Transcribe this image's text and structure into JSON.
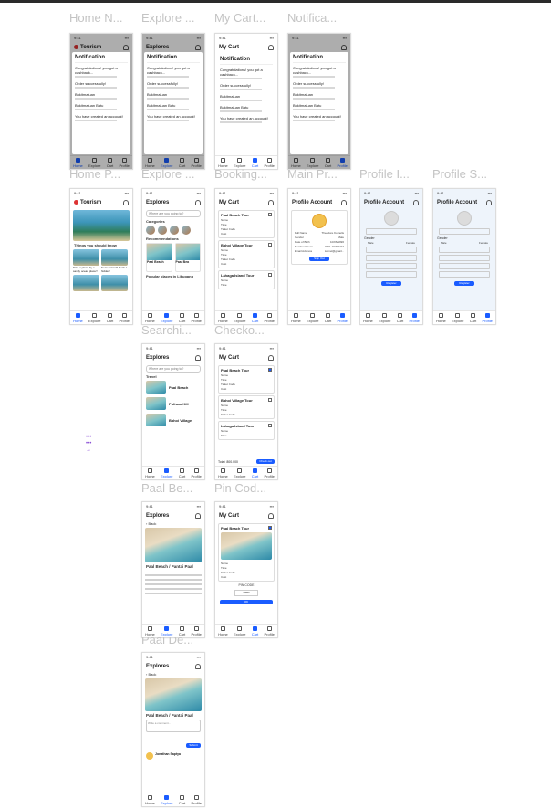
{
  "frames": {
    "home_notif": {
      "label": "Home N..."
    },
    "explore_notif": {
      "label": "Explore ..."
    },
    "cart_notif": {
      "label": "My Cart..."
    },
    "notif": {
      "label": "Notifica..."
    },
    "home_page": {
      "label": "Home P..."
    },
    "explore_page": {
      "label": "Explore ..."
    },
    "booking": {
      "label": "Booking..."
    },
    "main_profile": {
      "label": "Main Pr..."
    },
    "profile_info": {
      "label": "Profile I..."
    },
    "profile_s": {
      "label": "Profile S..."
    },
    "searching": {
      "label": "Searchi..."
    },
    "checkout": {
      "label": "Checko..."
    },
    "paal_beach": {
      "label": "Paal Be..."
    },
    "pin_code": {
      "label": "Pin Cod..."
    },
    "detail": {
      "label": "Paal De..."
    }
  },
  "app": {
    "status_time": "9:41",
    "home_title": "Tourism",
    "explore_title": "Explores",
    "cart_title": "My Cart",
    "profile_title": "Profile Account",
    "nav": {
      "home": "Home",
      "explore": "Explore",
      "cart": "Cart",
      "profile": "Profile"
    }
  },
  "notification": {
    "title": "Notification",
    "items": [
      "Congratulations! you got a cashback...",
      "Order successfully!",
      "Bukitmaluan",
      "Bukitmaluan Batu",
      "You have created an account!"
    ]
  },
  "home": {
    "things_title": "Things you should know",
    "things": [
      "Take a photo by a sandy ocean place!!",
      "Secret island! Such a hidden!"
    ]
  },
  "explore": {
    "search_placeholder": "Where are you going to?",
    "categories_title": "Categories",
    "recommendations_title": "Recommendations",
    "popular_title": "Popular places in Likupang",
    "cards": [
      "Paal Beach",
      "Paal Bea"
    ]
  },
  "cart": {
    "items": [
      "Paal Beach Tour",
      "Bahoi Village Tour",
      "Lahaga Island Tour"
    ],
    "fields": [
      "Name",
      "Time",
      "Ticket Code",
      "Cost"
    ],
    "total": "Total: 800.000",
    "checkout_button": "Check out",
    "pin_label": "PIN CODE",
    "pin_value": "******",
    "ok_button": "OK"
  },
  "profile": {
    "rows": [
      "Full Name",
      "Gender",
      "Date of Birth",
      "Number Phone",
      "Email Address"
    ],
    "values": [
      "Theodore Kornelis",
      "Male",
      "10/06/1996",
      "0851-19704422",
      "kornel@gmail..."
    ],
    "signout_button": "Sign Out",
    "gender_label": "Gender",
    "gender_options": [
      "Male",
      "Female"
    ],
    "save_button": "Register"
  },
  "search": {
    "placeholder": "Where are you going to?",
    "section": "Travel",
    "results": [
      "Paal Beach",
      "Pulisan Hill",
      "Bahoi Village"
    ]
  },
  "detail": {
    "back": "Back",
    "title": "Paal Beach / Pantai Paal",
    "comment_placeholder": "Write a comment...",
    "submit": "Submit",
    "commenter": "Jonathan Saptya"
  }
}
